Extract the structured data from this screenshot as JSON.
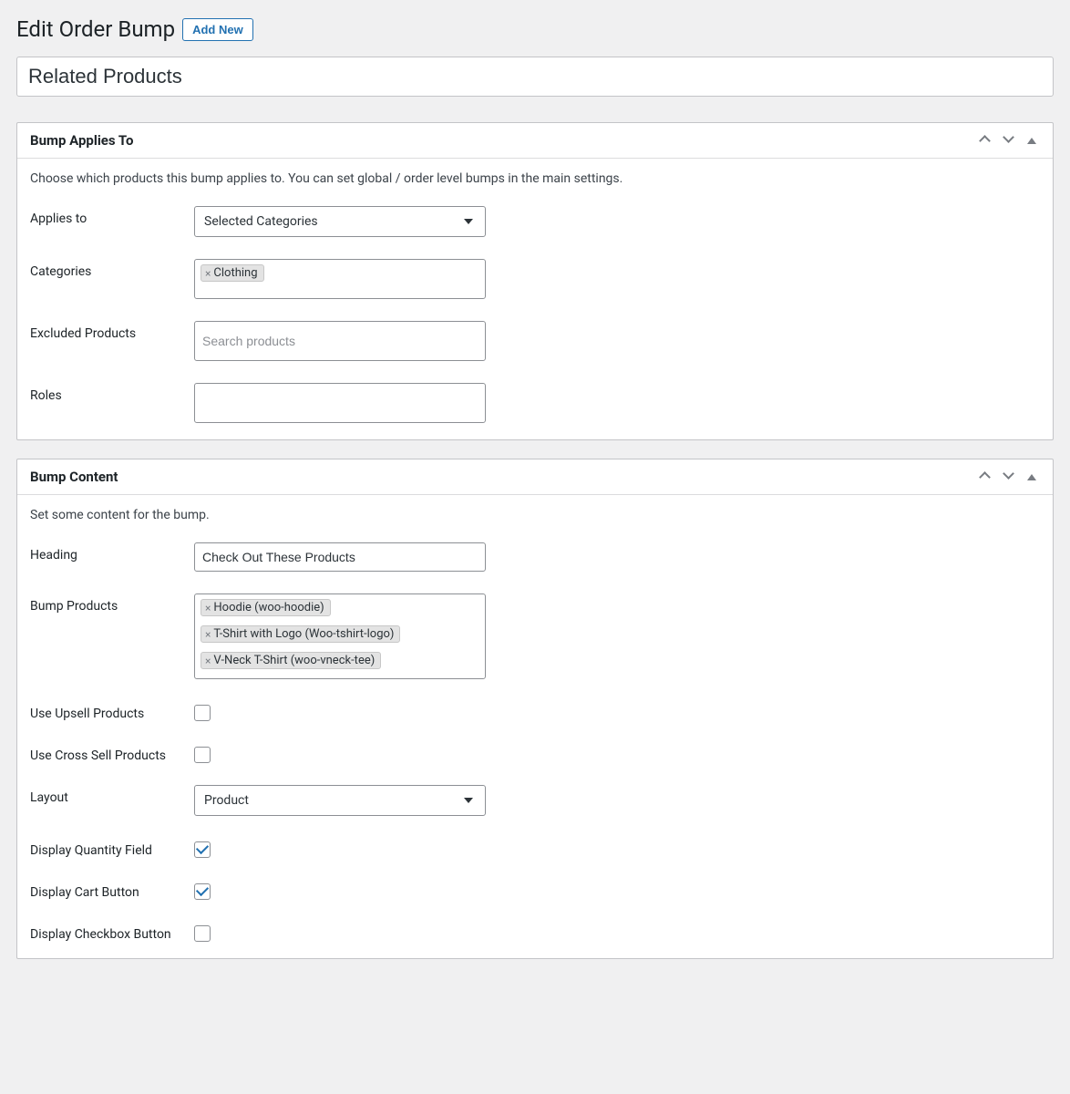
{
  "header": {
    "page_title": "Edit Order Bump",
    "add_new_label": "Add New",
    "title_value": "Related Products"
  },
  "section_applies": {
    "title": "Bump Applies To",
    "description": "Choose which products this bump applies to. You can set global / order level bumps in the main settings.",
    "labels": {
      "applies_to": "Applies to",
      "categories": "Categories",
      "excluded": "Excluded Products",
      "roles": "Roles"
    },
    "applies_to_value": "Selected Categories",
    "categories_tags": [
      "Clothing"
    ],
    "excluded_placeholder": "Search products"
  },
  "section_content": {
    "title": "Bump Content",
    "description": "Set some content for the bump.",
    "labels": {
      "heading": "Heading",
      "bump_products": "Bump Products",
      "use_upsell": "Use Upsell Products",
      "use_cross_sell": "Use Cross Sell Products",
      "layout": "Layout",
      "display_qty": "Display Quantity Field",
      "display_cart": "Display Cart Button",
      "display_checkbox": "Display Checkbox Button"
    },
    "heading_value": "Check Out These Products",
    "bump_products_tags": [
      "Hoodie (woo-hoodie)",
      "T-Shirt with Logo (Woo-tshirt-logo)",
      "V-Neck T-Shirt (woo-vneck-tee)"
    ],
    "use_upsell_checked": false,
    "use_cross_sell_checked": false,
    "layout_value": "Product",
    "display_qty_checked": true,
    "display_cart_checked": true,
    "display_checkbox_checked": false
  }
}
